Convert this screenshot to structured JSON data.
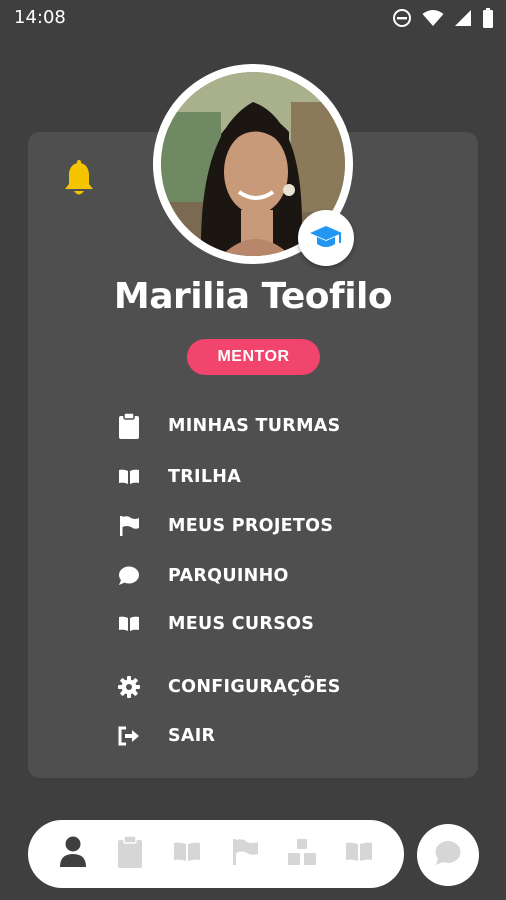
{
  "status_bar": {
    "time": "14:08",
    "icons": [
      "do-not-disturb-icon",
      "wifi-icon",
      "signal-icon",
      "battery-icon"
    ]
  },
  "profile": {
    "name": "Marilia Teofilo",
    "role_badge": "MENTOR",
    "role_badge_color": "#f2456d",
    "avatar_icon": "avatar",
    "badge_icon": "graduation-cap-icon"
  },
  "notifications": {
    "icon": "bell-icon",
    "color": "#f5c400"
  },
  "menu": {
    "items": [
      {
        "label": "MINHAS TURMAS",
        "icon": "clipboard-icon"
      },
      {
        "label": "TRILHA",
        "icon": "book-open-icon"
      },
      {
        "label": "MEUS PROJETOS",
        "icon": "flag-icon"
      },
      {
        "label": "PARQUINHO",
        "icon": "chat-bubble-icon"
      },
      {
        "label": "MEUS CURSOS",
        "icon": "book-open-icon"
      },
      {
        "label": "CONFIGURAÇÕES",
        "icon": "gear-icon"
      },
      {
        "label": "SAIR",
        "icon": "sign-out-icon"
      }
    ]
  },
  "bottom_nav": {
    "items": [
      "user-icon",
      "clipboard-icon",
      "book-open-icon",
      "flag-icon",
      "blocks-icon",
      "book-open-icon"
    ],
    "active": "user-icon"
  },
  "chat_button": {
    "icon": "chat-bubble-icon"
  },
  "colors": {
    "background": "#3f3f3f",
    "card": "#4f4f4f",
    "accent_blue": "#2196f3",
    "inactive_icon": "#d6d6d6"
  }
}
